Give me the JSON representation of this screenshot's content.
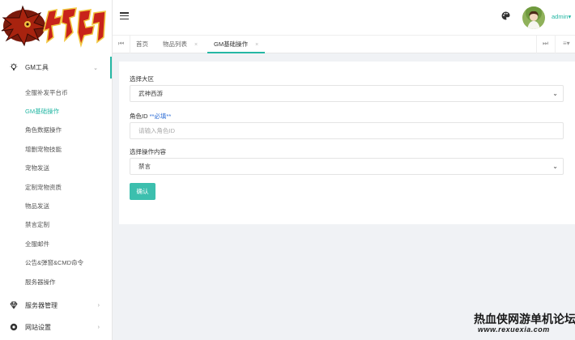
{
  "logo": {
    "text": "封神"
  },
  "sidebar": {
    "groups": [
      {
        "label": "GM工具",
        "icon": "bulb-icon",
        "expanded": true
      },
      {
        "label": "服务器管理",
        "icon": "diamond-icon",
        "expanded": false
      },
      {
        "label": "网站设置",
        "icon": "gear-icon",
        "expanded": false
      }
    ],
    "items": [
      "全服补发平台币",
      "GM基础操作",
      "角色数据操作",
      "增删宠物技能",
      "宠物发送",
      "定制宠物资质",
      "物品发送",
      "禁言定制",
      "全服邮件",
      "公告&弹窗&CMD命令",
      "服务器操作"
    ],
    "active_item": "GM基础操作"
  },
  "header": {
    "username": "admin",
    "caret": "▾"
  },
  "tabs": [
    {
      "label": "首页",
      "closable": false
    },
    {
      "label": "物品列表",
      "closable": true
    },
    {
      "label": "GM基础操作",
      "closable": true,
      "active": true
    }
  ],
  "tab_close_glyph": "×",
  "form": {
    "region_label": "选择大区",
    "region_value": "武神西游",
    "role_label": "角色ID",
    "role_hint": "**必填**",
    "role_placeholder": "请输入角色ID",
    "op_label": "选择操作内容",
    "op_value": "禁言",
    "submit_label": "确认"
  },
  "watermark": {
    "title": "热血侠网游单机论坛",
    "url": "www.rexuexia.com"
  },
  "colors": {
    "accent": "#25b7a4",
    "button": "#3cbfae",
    "hint": "#2e6ed6"
  }
}
